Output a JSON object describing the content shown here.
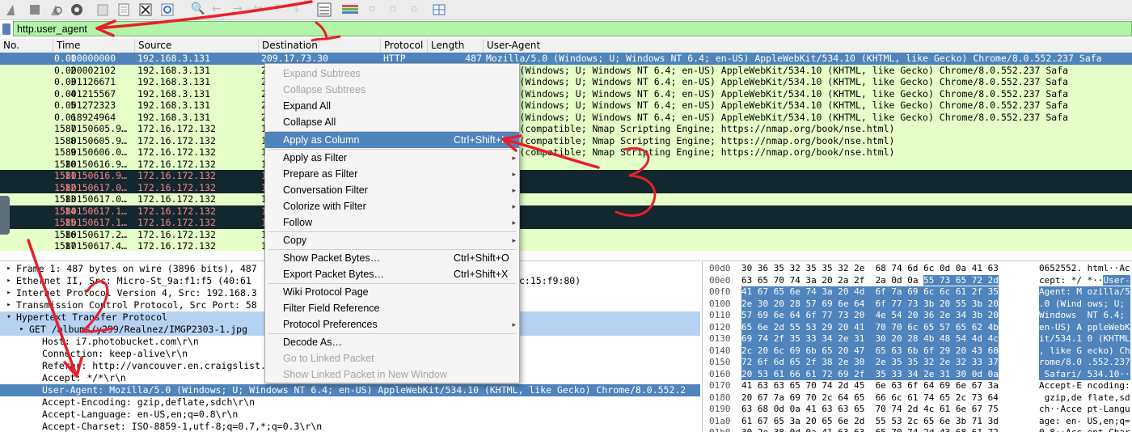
{
  "filter": {
    "value": "http.user_agent"
  },
  "columns": [
    "No.",
    "Time",
    "Source",
    "Destination",
    "Protocol",
    "Length",
    "User-Agent"
  ],
  "packets": [
    {
      "no": "1",
      "time": "0.000000000",
      "src": "192.168.3.131",
      "dst": "209.17.73.30",
      "proto": "HTTP",
      "len": "487",
      "ua": "Mozilla/5.0 (Windows; U; Windows NT 6.4; en-US) AppleWebKit/534.10 (KHTML, like Gecko) Chrome/8.0.552.237 Safa",
      "style": "sel"
    },
    {
      "no": "2",
      "time": "0.000002102",
      "src": "192.168.3.131",
      "dst": "2",
      "proto": "",
      "len": "",
      "ua": "a/5.0 (Windows; U; Windows NT 6.4; en-US) AppleWebKit/534.10 (KHTML, like Gecko) Chrome/8.0.552.237 Safa",
      "style": "green"
    },
    {
      "no": "3",
      "time": "0.001126671",
      "src": "192.168.3.131",
      "dst": "2",
      "proto": "",
      "len": "",
      "ua": "a/5.0 (Windows; U; Windows NT 6.4; en-US) AppleWebKit/534.10 (KHTML, like Gecko) Chrome/8.0.552.237 Safa",
      "style": "green"
    },
    {
      "no": "4",
      "time": "0.001215567",
      "src": "192.168.3.131",
      "dst": "2",
      "proto": "",
      "len": "",
      "ua": "a/5.0 (Windows; U; Windows NT 6.4; en-US) AppleWebKit/534.10 (KHTML, like Gecko) Chrome/8.0.552.237 Safa",
      "style": "green"
    },
    {
      "no": "5",
      "time": "0.001272323",
      "src": "192.168.3.131",
      "dst": "2",
      "proto": "",
      "len": "",
      "ua": "a/5.0 (Windows; U; Windows NT 6.4; en-US) AppleWebKit/534.10 (KHTML, like Gecko) Chrome/8.0.552.237 Safa",
      "style": "green"
    },
    {
      "no": "6",
      "time": "0.018924964",
      "src": "192.168.3.131",
      "dst": "2",
      "proto": "",
      "len": "",
      "ua": "a/5.0 (Windows; U; Windows NT 6.4; en-US) AppleWebKit/534.10 (KHTML, like Gecko) Chrome/8.0.552.237 Safa",
      "style": "green"
    },
    {
      "no": "7",
      "time": "1580150605.9…",
      "src": "172.16.172.132",
      "dst": "1",
      "proto": "",
      "len": "",
      "ua": "a/5.0 (compatible; Nmap Scripting Engine; https://nmap.org/book/nse.html)",
      "style": "green"
    },
    {
      "no": "8",
      "time": "1580150605.9…",
      "src": "172.16.172.132",
      "dst": "1",
      "proto": "",
      "len": "",
      "ua": "a/5.0 (compatible; Nmap Scripting Engine; https://nmap.org/book/nse.html)",
      "style": "green"
    },
    {
      "no": "9",
      "time": "1580150606.0…",
      "src": "172.16.172.132",
      "dst": "1",
      "proto": "",
      "len": "",
      "ua": "a/5.0 (compatible; Nmap Scripting Engine; https://nmap.org/book/nse.html)",
      "style": "green"
    },
    {
      "no": "10",
      "time": "1580150616.9…",
      "src": "172.16.172.132",
      "dst": "1",
      "proto": "",
      "len": "",
      "ua": "2.4",
      "style": "green"
    },
    {
      "no": "11",
      "time": "1580150616.9…",
      "src": "172.16.172.132",
      "dst": "1",
      "proto": "",
      "len": "",
      "ua": "2.4",
      "style": "dark"
    },
    {
      "no": "12",
      "time": "1580150617.0…",
      "src": "172.16.172.132",
      "dst": "1",
      "proto": "",
      "len": "",
      "ua": "2.4",
      "style": "dark"
    },
    {
      "no": "13",
      "time": "1580150617.0…",
      "src": "172.16.172.132",
      "dst": "1",
      "proto": "",
      "len": "",
      "ua": "2.4",
      "style": "green"
    },
    {
      "no": "14",
      "time": "1580150617.1…",
      "src": "172.16.172.132",
      "dst": "1",
      "proto": "",
      "len": "",
      "ua": "2.4",
      "style": "dark"
    },
    {
      "no": "15",
      "time": "1580150617.1…",
      "src": "172.16.172.132",
      "dst": "1",
      "proto": "",
      "len": "",
      "ua": "2.4",
      "style": "dark"
    },
    {
      "no": "16",
      "time": "1580150617.2…",
      "src": "172.16.172.132",
      "dst": "1",
      "proto": "",
      "len": "",
      "ua": "2.4",
      "style": "green"
    },
    {
      "no": "17",
      "time": "1580150617.4…",
      "src": "172.16.172.132",
      "dst": "1",
      "proto": "",
      "len": "",
      "ua": "2.4",
      "style": "green"
    }
  ],
  "detail": [
    {
      "text": "Frame 1: 487 bytes on wire (3896 bits), 487",
      "tail": "",
      "arrow": "▸",
      "indent": 0,
      "style": ""
    },
    {
      "text": "Ethernet II, Src: Micro-St_9a:f1:f5 (40:61",
      "tail": "c:15:f9:80)",
      "arrow": "▸",
      "indent": 0,
      "style": ""
    },
    {
      "text": "Internet Protocol Version 4, Src: 192.168.3",
      "tail": "",
      "arrow": "▸",
      "indent": 0,
      "style": ""
    },
    {
      "text": "Transmission Control Protocol, Src Port: 58",
      "tail": "",
      "arrow": "▸",
      "indent": 0,
      "style": ""
    },
    {
      "text": "Hypertext Transfer Protocol",
      "tail": "",
      "arrow": "▾",
      "indent": 0,
      "style": "hl"
    },
    {
      "text": "GET /albums/y299/Realnez/IMGP2303-1.jpg",
      "tail": "",
      "arrow": "▸",
      "indent": 1,
      "style": "hl"
    },
    {
      "text": "Host: i7.photobucket.com\\r\\n",
      "tail": "",
      "arrow": "",
      "indent": 2,
      "style": ""
    },
    {
      "text": "Connection: keep-alive\\r\\n",
      "tail": "",
      "arrow": "",
      "indent": 2,
      "style": ""
    },
    {
      "text": "Referer: http://vancouver.en.craigslist.c",
      "tail": "",
      "arrow": "",
      "indent": 2,
      "style": ""
    },
    {
      "text": "Accept: */*\\r\\n",
      "tail": "",
      "arrow": "",
      "indent": 2,
      "style": ""
    },
    {
      "text": "User-Agent: Mozilla/5.0 (Windows; U; Windows NT 6.4; en-US) AppleWebKit/534.10 (KHTML, like Gecko) Chrome/8.0.552.2",
      "tail": "",
      "arrow": "",
      "indent": 2,
      "style": "sel"
    },
    {
      "text": "Accept-Encoding: gzip,deflate,sdch\\r\\n",
      "tail": "",
      "arrow": "",
      "indent": 2,
      "style": ""
    },
    {
      "text": "Accept-Language: en-US,en;q=0.8\\r\\n",
      "tail": "",
      "arrow": "",
      "indent": 2,
      "style": ""
    },
    {
      "text": "Accept-Charset: ISO-8859-1,utf-8;q=0.7,*;q=0.3\\r\\n",
      "tail": "",
      "arrow": "",
      "indent": 2,
      "style": ""
    },
    {
      "text": "\\r\\n",
      "tail": "",
      "arrow": "",
      "indent": 2,
      "style": ""
    }
  ],
  "hex": [
    {
      "off": "00d0",
      "bytes": "30 36 35 32 35 35 32 2e  68 74 6d 6c 0d 0a 41 63",
      "ascii": "0652552. html··Ac",
      "sel": "none"
    },
    {
      "off": "00e0",
      "bytes_a": "63 65 70 74 3a 20 2a 2f  2a 0d 0a ",
      "bytes_b": "55 73 65 72 2d",
      "ascii_a": "cept: */ *··",
      "ascii_b": "User-",
      "sel": "part"
    },
    {
      "off": "00f0",
      "bytes": "41 67 65 6e 74 3a 20 4d  6f 7a 69 6c 6c 61 2f 35",
      "ascii": "Agent: M ozilla/5",
      "sel": "full"
    },
    {
      "off": "0100",
      "bytes": "2e 30 20 28 57 69 6e 64  6f 77 73 3b 20 55 3b 20",
      "ascii": ".0 (Wind ows; U; ",
      "sel": "full"
    },
    {
      "off": "0110",
      "bytes": "57 69 6e 64 6f 77 73 20  4e 54 20 36 2e 34 3b 20",
      "ascii": "Windows  NT 6.4; ",
      "sel": "full"
    },
    {
      "off": "0120",
      "bytes": "65 6e 2d 55 53 29 20 41  70 70 6c 65 57 65 62 4b",
      "ascii": "en-US) A ppleWebK",
      "sel": "full"
    },
    {
      "off": "0130",
      "bytes": "69 74 2f 35 33 34 2e 31  30 20 28 4b 48 54 4d 4c",
      "ascii": "it/534.1 0 (KHTML",
      "sel": "full"
    },
    {
      "off": "0140",
      "bytes": "2c 20 6c 69 6b 65 20 47  65 63 6b 6f 29 20 43 68",
      "ascii": ", like G ecko) Ch",
      "sel": "full"
    },
    {
      "off": "0150",
      "bytes": "72 6f 6d 65 2f 38 2e 30  2e 35 35 32 2e 32 33 37",
      "ascii": "rome/8.0 .552.237",
      "sel": "full"
    },
    {
      "off": "0160",
      "bytes": "20 53 61 66 61 72 69 2f  35 33 34 2e 31 30 0d 0a",
      "ascii": " Safari/ 534.10··",
      "sel": "full"
    },
    {
      "off": "0170",
      "bytes": "41 63 63 65 70 74 2d 45  6e 63 6f 64 69 6e 67 3a",
      "ascii": "Accept-E ncoding:",
      "sel": "none"
    },
    {
      "off": "0180",
      "bytes": "20 67 7a 69 70 2c 64 65  66 6c 61 74 65 2c 73 64",
      "ascii": " gzip,de flate,sd",
      "sel": "none"
    },
    {
      "off": "0190",
      "bytes": "63 68 0d 0a 41 63 63 65  70 74 2d 4c 61 6e 67 75",
      "ascii": "ch··Acce pt-Langu",
      "sel": "none"
    },
    {
      "off": "01a0",
      "bytes": "61 67 65 3a 20 65 6e 2d  55 53 2c 65 6e 3b 71 3d",
      "ascii": "age: en- US,en;q=",
      "sel": "none"
    },
    {
      "off": "01b0",
      "bytes": "30 2e 38 0d 0a 41 63 63  65 70 74 2d 43 68 61 72",
      "ascii": "0.8··Acc ept-Char",
      "sel": "none"
    }
  ],
  "menu": [
    {
      "label": "Expand Subtrees",
      "shortcut": "",
      "submenu": false,
      "state": "dis"
    },
    {
      "label": "Collapse Subtrees",
      "shortcut": "",
      "submenu": false,
      "state": "dis"
    },
    {
      "label": "Expand All",
      "shortcut": "",
      "submenu": false,
      "state": ""
    },
    {
      "label": "Collapse All",
      "shortcut": "",
      "submenu": false,
      "state": ""
    },
    {
      "sep": true
    },
    {
      "label": "Apply as Column",
      "shortcut": "Ctrl+Shift+I",
      "submenu": false,
      "state": "hi"
    },
    {
      "sep": true
    },
    {
      "label": "Apply as Filter",
      "shortcut": "",
      "submenu": true,
      "state": ""
    },
    {
      "label": "Prepare as Filter",
      "shortcut": "",
      "submenu": true,
      "state": ""
    },
    {
      "label": "Conversation Filter",
      "shortcut": "",
      "submenu": true,
      "state": ""
    },
    {
      "label": "Colorize with Filter",
      "shortcut": "",
      "submenu": true,
      "state": ""
    },
    {
      "label": "Follow",
      "shortcut": "",
      "submenu": true,
      "state": ""
    },
    {
      "sep": true
    },
    {
      "label": "Copy",
      "shortcut": "",
      "submenu": true,
      "state": ""
    },
    {
      "sep": true
    },
    {
      "label": "Show Packet Bytes…",
      "shortcut": "Ctrl+Shift+O",
      "submenu": false,
      "state": ""
    },
    {
      "label": "Export Packet Bytes…",
      "shortcut": "Ctrl+Shift+X",
      "submenu": false,
      "state": ""
    },
    {
      "sep": true
    },
    {
      "label": "Wiki Protocol Page",
      "shortcut": "",
      "submenu": false,
      "state": ""
    },
    {
      "label": "Filter Field Reference",
      "shortcut": "",
      "submenu": false,
      "state": ""
    },
    {
      "label": "Protocol Preferences",
      "shortcut": "",
      "submenu": true,
      "state": ""
    },
    {
      "sep": true
    },
    {
      "label": "Decode As…",
      "shortcut": "",
      "submenu": false,
      "state": ""
    },
    {
      "label": "Go to Linked Packet",
      "shortcut": "",
      "submenu": false,
      "state": "dis"
    },
    {
      "label": "Show Linked Packet in New Window",
      "shortcut": "",
      "submenu": false,
      "state": "dis"
    }
  ],
  "colors": {
    "selected": "#4f84bd",
    "green_row": "#e4ffc7",
    "dark_row": "#12272e",
    "dark_row_text": "#f78787",
    "filter_ok": "#b2f5a9",
    "annotation": "#e8202a"
  },
  "toolbar_icons": [
    "shark-fin-icon",
    "stop-icon",
    "restart-icon",
    "options-gear-icon",
    "open-file-icon",
    "save-icon",
    "close-file-icon",
    "reload-icon",
    "back-icon",
    "forward-icon",
    "go-to-packet-icon",
    "first-packet-icon",
    "last-packet-icon",
    "autoscroll-icon",
    "colorize-icon",
    "zoom-in-icon",
    "zoom-out-icon",
    "normal-size-icon",
    "resize-columns-icon"
  ]
}
